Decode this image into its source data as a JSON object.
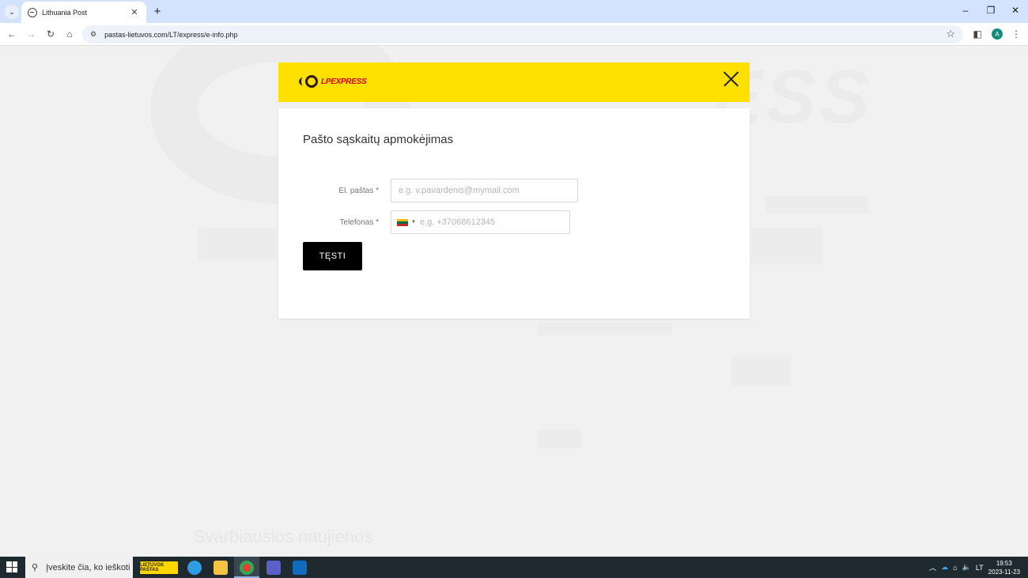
{
  "browser": {
    "tab_title": "Lithuania Post",
    "url": "pastas-lietuvos.com/LT/express/e-info.php",
    "profile_initial": "A"
  },
  "background": {
    "watermark": "ESS",
    "heading": "Svarbiausios naujienos"
  },
  "modal": {
    "logo_text": "LPEXPRESS",
    "title": "Pašto sąskaitų apmokėjimas",
    "email_label": "El. paštas *",
    "email_placeholder": "e.g. v.pavardenis@mymail.com",
    "phone_label": "Telefonas *",
    "phone_placeholder": "e.g. +37068612345",
    "submit_label": "TĘSTI",
    "colors": {
      "header": "#ffe000",
      "logo_text": "#d6001c",
      "button": "#000000"
    }
  },
  "taskbar": {
    "search_placeholder": "Įveskite čia, ko ieškoti",
    "post_app_label": "LIETUVOS PAŠTAS",
    "language": "LT",
    "time": "19:53",
    "date": "2023-11-23"
  }
}
